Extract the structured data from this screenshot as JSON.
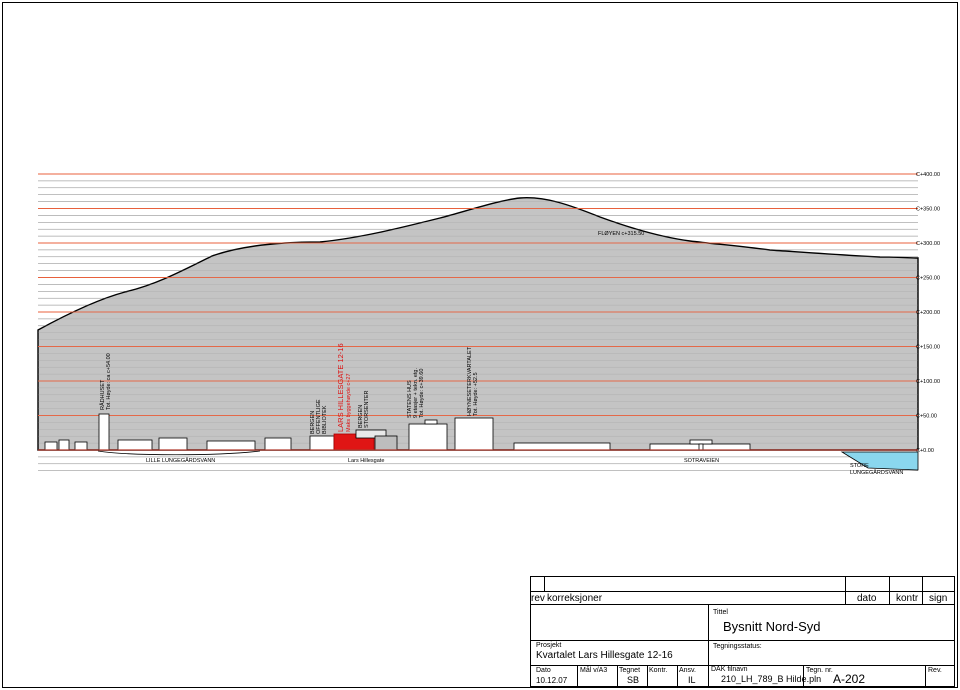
{
  "section": {
    "levels": [
      {
        "value": 400,
        "label": "C+400.00"
      },
      {
        "value": 350,
        "label": "C+350.00"
      },
      {
        "value": 300,
        "label": "C+300.00"
      },
      {
        "value": 250,
        "label": "C+250.00"
      },
      {
        "value": 200,
        "label": "C+200.00"
      },
      {
        "value": 150,
        "label": "C+150.00"
      },
      {
        "value": 100,
        "label": "C+100.00"
      },
      {
        "value": 50,
        "label": "C+50.00"
      },
      {
        "value": 0,
        "label": "C+0.00"
      }
    ],
    "peak_label": "FLØYEN c+315.50",
    "ground_labels": {
      "lille": "LILLE LUNGEGÅRDSVANN",
      "lars": "Lars Hillesgate",
      "sotra": "SOTRAVEIEN",
      "store_1": "STORE",
      "store_2": "LUNGEGÅRDSVANN"
    },
    "building_labels": {
      "rad_1": "RÅDHUSET",
      "rad_2": "Tot. Høyde: ca c+54.00",
      "bib_1": "BERGEN",
      "bib_2": "OFFENTLIGE",
      "bib_3": "BIBLIOTEK",
      "lars_1": "LARS HILLESGATE 12-16",
      "lars_2": "Maks byggehøyde c+27",
      "sto_1": "BERGEN",
      "sto_2": "STORSENTER",
      "stat_1": "STATENS HUS",
      "stat_2": "9 etasjer + tekn. etg.",
      "stat_3": "Tot. Høyde: c+39.60",
      "hdy_1": "HØYNESETERKVARTALET",
      "hdy_2": "Tot. Høyde: +52.5"
    }
  },
  "title_block": {
    "rev_header": "rev",
    "korreksjoner_header": "korreksjoner",
    "dato_header": "dato",
    "kontr_header": "kontr",
    "sign_header": "sign",
    "tittel_label": "Tittel",
    "tittel_value": "Bysnitt Nord-Syd",
    "prosjekt_label": "Prosjekt",
    "prosjekt_value": "Kvartalet Lars Hillesgate 12-16",
    "tegningsstatus_label": "Tegningsstatus:",
    "dato_label": "Dato",
    "dato_value": "10.12.07",
    "mal_label": "Mål v/A3",
    "tegnet_label": "Tegnet",
    "tegnet_value": "SB",
    "kontr_label": "Kontr.",
    "ansv_label": "Ansv.",
    "ansv_value": "IL",
    "dak_label": "DAK filnavn",
    "dak_value": "210_LH_789_B Hilde.pln",
    "tegn_nr_label": "Tegn. nr.",
    "tegn_nr_value": "A-202",
    "rev_label": "Rev."
  }
}
